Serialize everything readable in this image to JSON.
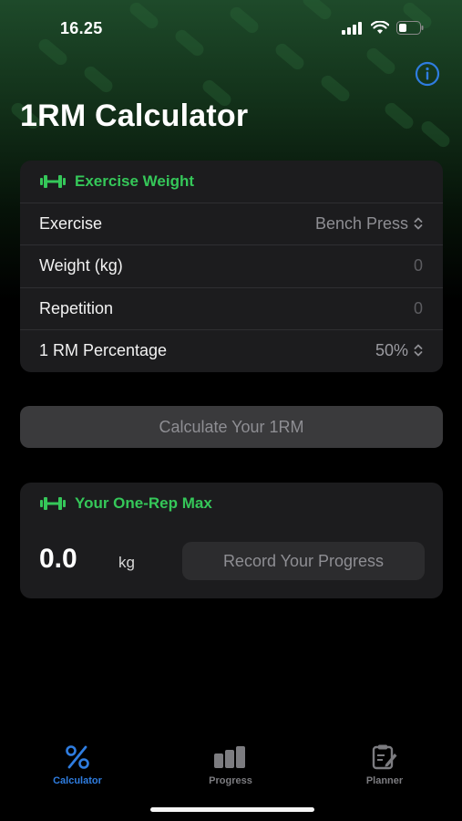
{
  "status_bar": {
    "time": "16.25",
    "icons": [
      "cellular-signal-icon",
      "wifi-icon",
      "battery-icon"
    ]
  },
  "header": {
    "title": "1RM Calculator",
    "info_icon": "info-icon"
  },
  "exercise_card": {
    "title": "Exercise Weight",
    "icon": "dumbbell-icon",
    "rows": [
      {
        "label": "Exercise",
        "value": "Bench Press"
      },
      {
        "label": "Weight (kg)",
        "value": "0"
      },
      {
        "label": "Repetition",
        "value": "0"
      },
      {
        "label": "1 RM Percentage",
        "value": "50%"
      }
    ]
  },
  "calculate_button": {
    "label": "Calculate Your 1RM"
  },
  "result_card": {
    "title": "Your One-Rep Max",
    "icon": "dumbbell-icon",
    "value": "0.0",
    "unit": "kg",
    "record_button": "Record Your Progress"
  },
  "tab_bar": {
    "tabs": [
      {
        "label": "Calculator",
        "icon": "percent-icon",
        "active": true
      },
      {
        "label": "Progress",
        "icon": "bar-chart-icon",
        "active": false
      },
      {
        "label": "Planner",
        "icon": "clipboard-edit-icon",
        "active": false
      }
    ]
  },
  "colors": {
    "accent_green": "#35c759",
    "accent_blue": "#2f7de0",
    "card_bg": "#1c1c1e",
    "button_bg": "#3a3a3c",
    "background": "#000000"
  }
}
